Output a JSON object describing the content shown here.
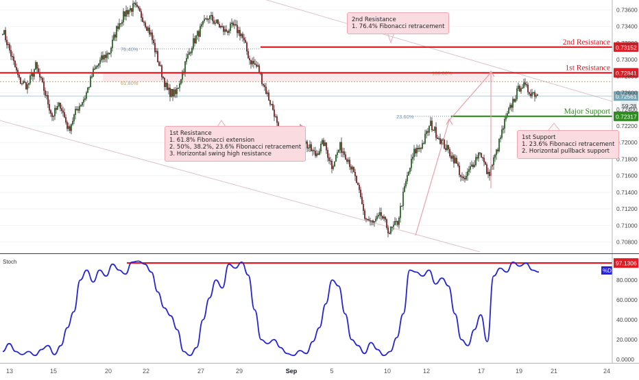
{
  "colors": {
    "resistance": "#e01b24",
    "support": "#2e8b1f",
    "bull_candle": "#2f8f2a",
    "bear_candle": "#b3282d",
    "stoch_line": "#2525d6",
    "fib": "#c8a044",
    "fib_blue": "#6f8fbf",
    "note_bg": "#fadbe0",
    "current_price": "#7aa7b5"
  },
  "chart_data": [
    {
      "type": "candlestick",
      "ylim": [
        0.7068,
        0.7372
      ],
      "price_ticks": [
        "0.73600",
        "0.73400",
        "0.73200",
        "0.73000",
        "0.72800",
        "0.72600",
        "0.72400",
        "0.72200",
        "0.72000",
        "0.71800",
        "0.71600",
        "0.71400",
        "0.71200",
        "0.71000",
        "0.70800"
      ],
      "x_tick_labels": [
        "13",
        "15",
        "20",
        "22",
        "27",
        "29",
        "Sep",
        "5",
        "10",
        "12",
        "17",
        "19",
        "21",
        "24"
      ],
      "close_path": [
        0.7336,
        0.7306,
        0.7275,
        0.7268,
        0.7292,
        0.7264,
        0.7232,
        0.7246,
        0.7215,
        0.724,
        0.7255,
        0.7285,
        0.73,
        0.731,
        0.7342,
        0.7358,
        0.7364,
        0.7351,
        0.733,
        0.7294,
        0.7262,
        0.7258,
        0.729,
        0.7318,
        0.7336,
        0.7352,
        0.7344,
        0.7334,
        0.734,
        0.7331,
        0.73,
        0.729,
        0.7262,
        0.7236,
        0.719,
        0.7208,
        0.7215,
        0.7196,
        0.7185,
        0.72,
        0.7172,
        0.7195,
        0.718,
        0.7152,
        0.711,
        0.7102,
        0.7112,
        0.7092,
        0.7104,
        0.7152,
        0.7188,
        0.7198,
        0.7222,
        0.7206,
        0.7192,
        0.7178,
        0.7152,
        0.7172,
        0.719,
        0.716,
        0.7188,
        0.7224,
        0.725,
        0.727,
        0.7262,
        0.7258
      ],
      "levels": [
        {
          "name": "2nd Resistance",
          "price_label": "0.73152",
          "price": 0.73152
        },
        {
          "name": "1st Resistance",
          "price_label": "0.72841",
          "price": 0.72841
        },
        {
          "name": "Major Support",
          "price_label": "0.72317",
          "price": 0.72317
        }
      ],
      "current_price": {
        "price_label": "0.72561",
        "price": 0.72561,
        "countdown": "59:28"
      },
      "fib_labels": [
        "76.40%",
        "61.80%",
        "100.00%",
        "23.60%"
      ],
      "annotations": {
        "res2": {
          "lines": [
            "2nd Resistance",
            "1. 76.4% Fibonacci retracement"
          ]
        },
        "res1": {
          "lines": [
            "1st Resistance",
            "1. 61.8% Fibonacci extension",
            "2. 50%, 38.2%, 23.6% Fibonacci retracement",
            "3. Horizontal swing high resistance"
          ]
        },
        "sup1": {
          "lines": [
            "1st Support",
            "1. 23.6% Fibonacci retracement",
            "2. Horizontal pullback support"
          ]
        }
      }
    },
    {
      "type": "line",
      "title": "Stoch",
      "series": [
        {
          "name": "%D",
          "values": [
            8,
            16,
            8,
            5,
            8,
            4,
            10,
            14,
            5,
            14,
            32,
            48,
            80,
            90,
            78,
            90,
            84,
            96,
            90,
            86,
            98,
            99,
            96,
            88,
            68,
            52,
            44,
            30,
            8,
            4,
            12,
            40,
            62,
            80,
            72,
            96,
            92,
            98,
            85,
            50,
            20,
            16,
            20,
            12,
            6,
            4,
            9,
            6,
            18,
            32,
            56,
            80,
            74,
            46,
            20,
            14,
            6,
            17,
            10,
            4,
            8,
            22,
            46,
            90,
            88,
            84,
            90,
            76,
            82,
            74,
            46,
            20,
            14,
            30,
            45,
            18,
            84,
            92,
            88,
            98,
            94,
            97,
            90,
            88
          ]
        }
      ],
      "ylim": [
        0,
        100
      ],
      "y_ticks": [
        "80.0000",
        "60.0000",
        "40.0000",
        "20.0000",
        "0.0000"
      ],
      "overbought_label": "97.1306",
      "overbought": 97.1306
    }
  ]
}
